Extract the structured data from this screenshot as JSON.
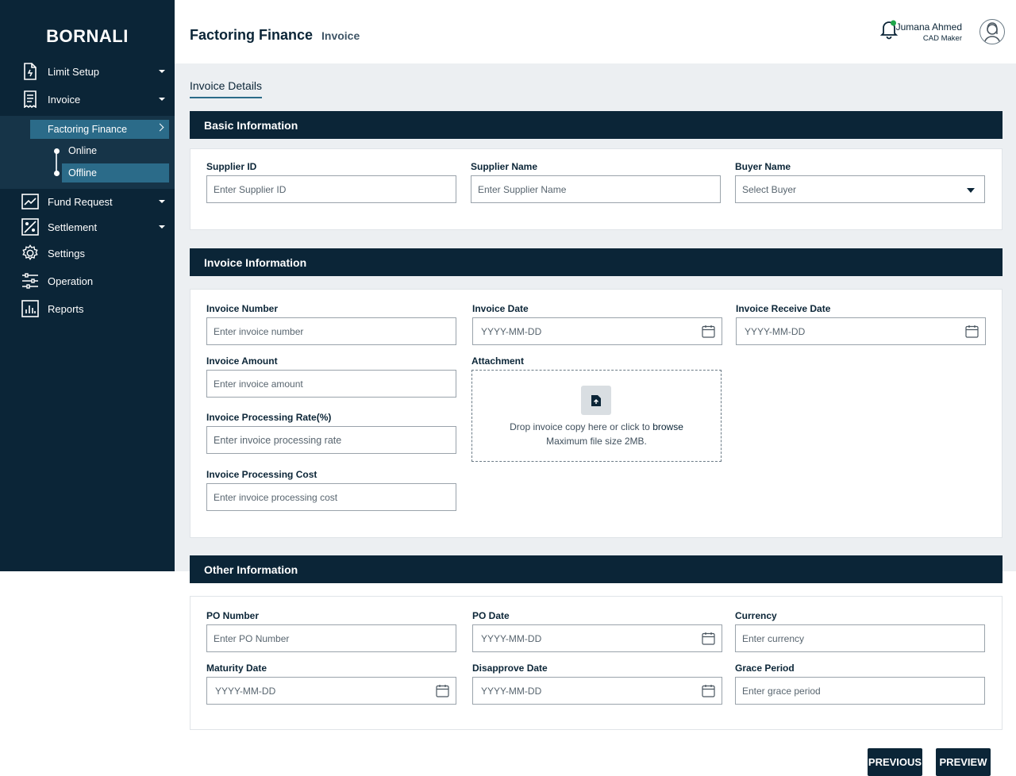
{
  "brand": "BORNALI",
  "sidebar": {
    "items": [
      {
        "label": "Limit Setup"
      },
      {
        "label": "Invoice"
      },
      {
        "label": "Fund Request"
      },
      {
        "label": "Settlement"
      },
      {
        "label": "Settings"
      },
      {
        "label": "Operation"
      },
      {
        "label": "Reports"
      }
    ],
    "submenu": {
      "label": "Factoring Finance",
      "children": [
        {
          "label": "Online"
        },
        {
          "label": "Offline"
        }
      ]
    }
  },
  "header": {
    "title": "Factoring Finance",
    "subtitle": "Invoice",
    "user_name": "Jumana Ahmed",
    "user_role": "CAD Maker"
  },
  "tab": "Invoice Details",
  "basic": {
    "heading": "Basic Information",
    "supplier_id": {
      "label": "Supplier ID",
      "placeholder": "Enter Supplier ID"
    },
    "supplier_name": {
      "label": "Supplier Name",
      "placeholder": "Enter Supplier Name"
    },
    "buyer_name": {
      "label": "Buyer Name",
      "placeholder": "Select Buyer"
    }
  },
  "invoice": {
    "heading": "Invoice Information",
    "number": {
      "label": "Invoice Number",
      "placeholder": "Enter invoice number"
    },
    "date": {
      "label": "Invoice Date",
      "placeholder": "YYYY-MM-DD"
    },
    "receive_date": {
      "label": "Invoice Receive Date",
      "placeholder": "YYYY-MM-DD"
    },
    "amount": {
      "label": "Invoice Amount",
      "placeholder": "Enter invoice amount"
    },
    "attachment": {
      "label": "Attachment",
      "text": "Drop invoice copy here or click to",
      "link": "browse",
      "hint": "Maximum file size 2MB."
    },
    "rate": {
      "label": "Invoice Processing Rate(%)",
      "placeholder": "Enter invoice processing rate"
    },
    "cost": {
      "label": "Invoice Processing Cost",
      "placeholder": "Enter invoice processing cost"
    }
  },
  "other": {
    "heading": "Other Information",
    "po_number": {
      "label": "PO Number",
      "placeholder": "Enter PO Number"
    },
    "po_date": {
      "label": "PO Date",
      "placeholder": "YYYY-MM-DD"
    },
    "currency": {
      "label": "Currency",
      "placeholder": "Enter currency"
    },
    "maturity_date": {
      "label": "Maturity Date",
      "placeholder": "YYYY-MM-DD"
    },
    "disapprove_date": {
      "label": "Disapprove Date",
      "placeholder": "YYYY-MM-DD"
    },
    "grace_period": {
      "label": "Grace Period",
      "placeholder": "Enter grace period"
    }
  },
  "buttons": {
    "previous": "PREVIOUS",
    "preview": "PREVIEW"
  },
  "colors": {
    "navy": "#0b2537",
    "accent": "#2b6b89",
    "notify": "#1fa64a"
  }
}
